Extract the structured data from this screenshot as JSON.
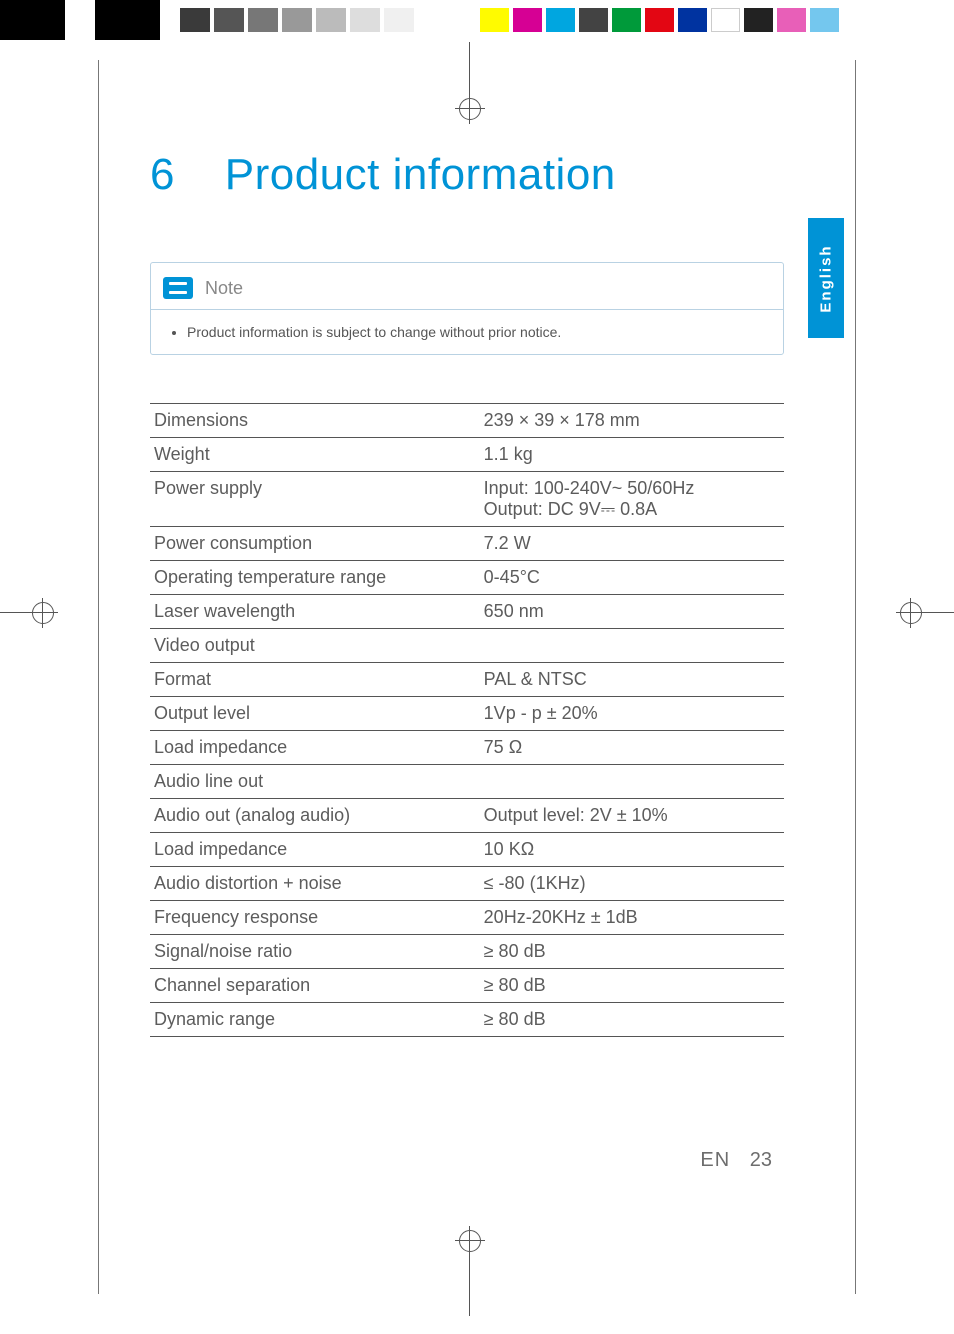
{
  "page": {
    "language_tab": "English",
    "footer_label": "EN",
    "page_number": "23"
  },
  "heading": {
    "number": "6",
    "title": "Product information"
  },
  "note": {
    "label": "Note",
    "items": [
      "Product information is subject to change without prior notice."
    ]
  },
  "specs": [
    {
      "label": "Dimensions",
      "value": "239 × 39 × 178 mm"
    },
    {
      "label": "Weight",
      "value": "1.1 kg"
    },
    {
      "label": "Power supply",
      "value": "Input: 100-240V~ 50/60Hz\nOutput: DC 9V⎓ 0.8A"
    },
    {
      "label": "Power consumption",
      "value": "7.2 W"
    },
    {
      "label": "Operating temperature range",
      "value": "0-45°C"
    },
    {
      "label": "Laser wavelength",
      "value": "650 nm"
    },
    {
      "label": "Video output",
      "value": ""
    },
    {
      "label": "Format",
      "value": "PAL & NTSC"
    },
    {
      "label": "Output level",
      "value": "1Vp - p ± 20%"
    },
    {
      "label": "Load impedance",
      "value": "75 Ω"
    },
    {
      "label": "Audio line out",
      "value": ""
    },
    {
      "label": "Audio out (analog audio)",
      "value": " Output level: 2V ± 10%"
    },
    {
      "label": "Load impedance",
      "value": "10 KΩ"
    },
    {
      "label": "Audio distortion + noise",
      "value": "≤ -80 (1KHz)"
    },
    {
      "label": "Frequency response",
      "value": "20Hz-20KHz ± 1dB"
    },
    {
      "label": "Signal/noise ratio",
      "value": "≥ 80 dB"
    },
    {
      "label": "Channel separation",
      "value": "≥ 80 dB"
    },
    {
      "label": "Dynamic range",
      "value": "≥ 80 dB"
    }
  ]
}
